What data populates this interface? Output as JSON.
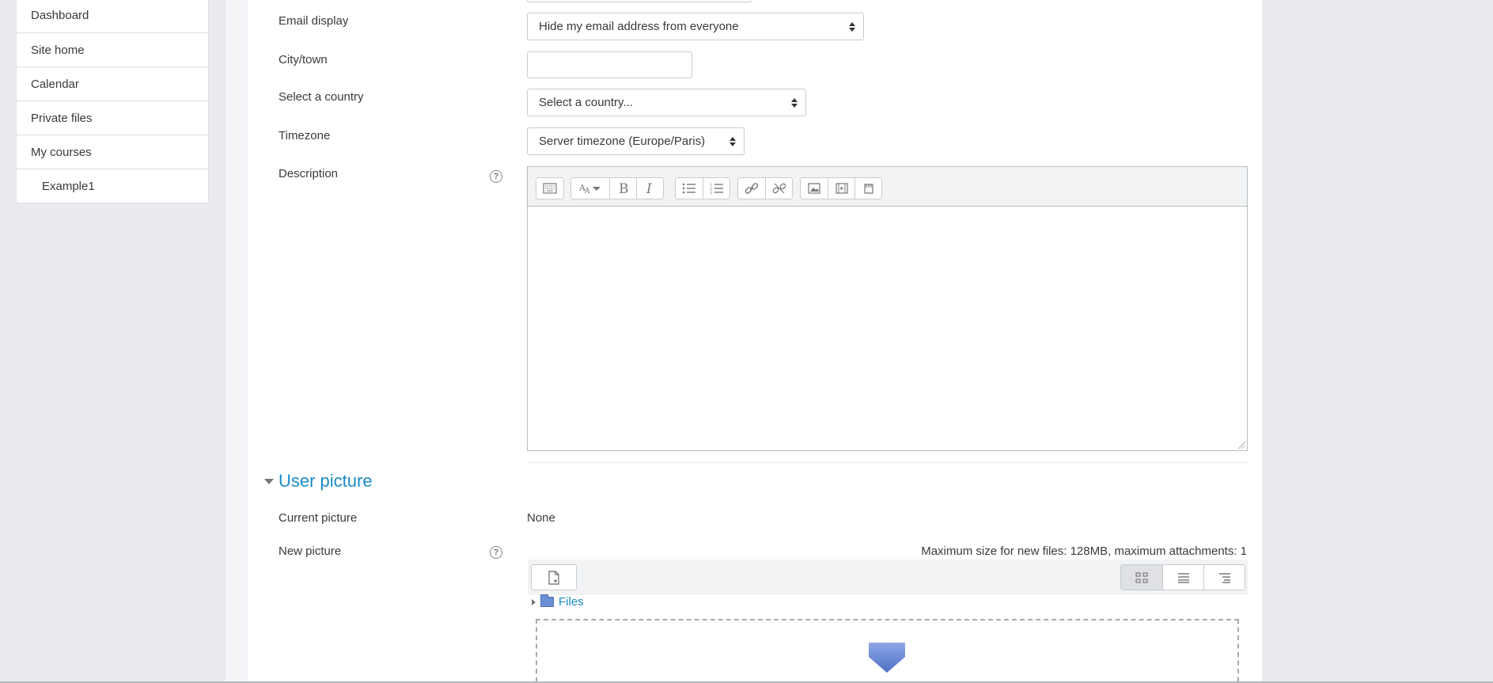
{
  "nav": {
    "items": [
      {
        "label": "Dashboard"
      },
      {
        "label": "Site home"
      },
      {
        "label": "Calendar"
      },
      {
        "label": "Private files"
      },
      {
        "label": "My courses"
      },
      {
        "label": "Example1"
      }
    ]
  },
  "form": {
    "email_display": {
      "label": "Email display",
      "value": "Hide my email address from everyone"
    },
    "city": {
      "label": "City/town",
      "value": ""
    },
    "country": {
      "label": "Select a country",
      "value": "Select a country..."
    },
    "timezone": {
      "label": "Timezone",
      "value": "Server timezone (Europe/Paris)"
    },
    "description": {
      "label": "Description",
      "help_icon": "?"
    }
  },
  "editor": {
    "toolbar_icons": [
      "collapse-icon",
      "font-style-icon",
      "bold-icon",
      "italic-icon",
      "unordered-list-icon",
      "ordered-list-icon",
      "link-icon",
      "unlink-icon",
      "image-icon",
      "media-icon",
      "manage-files-icon"
    ]
  },
  "user_picture": {
    "section_title": "User picture",
    "current_label": "Current picture",
    "current_value": "None",
    "new_label": "New picture",
    "help_icon": "?",
    "max_info": "Maximum size for new files: 128MB, maximum attachments: 1",
    "files_label": "Files"
  },
  "colors": {
    "link": "#1a8cc6",
    "background": "#e9ebee",
    "card": "#ffffff"
  }
}
